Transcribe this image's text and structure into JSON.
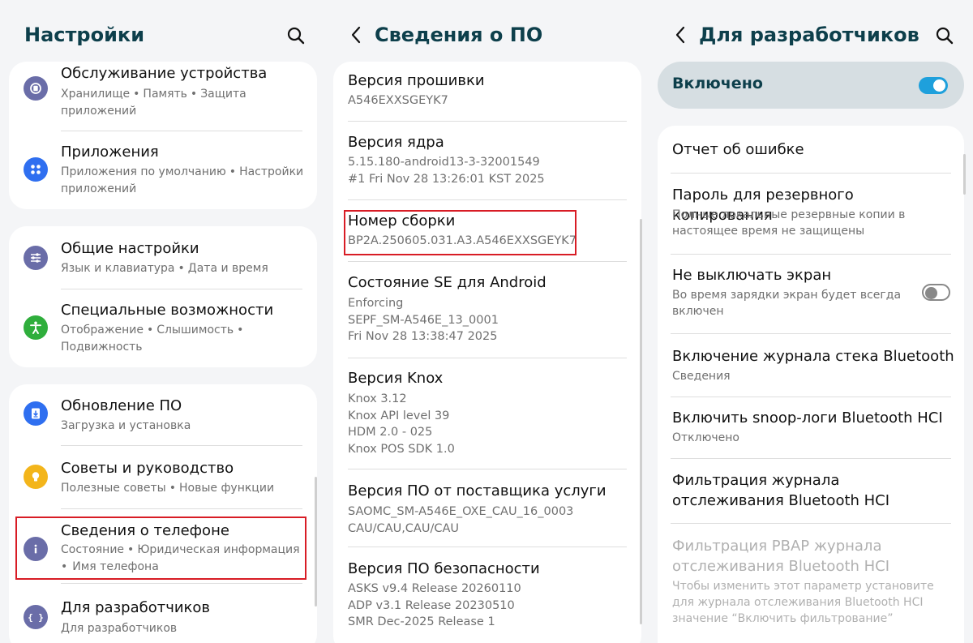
{
  "settings": {
    "title": "Настройки",
    "items": [
      {
        "title": "Обслуживание устройства",
        "sub_line1": [
          "Хранилище",
          "Память",
          "Защита"
        ],
        "sub_line2": "приложений"
      },
      {
        "title": "Приложения",
        "sub_line1": [
          "Приложения по умолчанию",
          "Настройки"
        ],
        "sub_line2": "приложений"
      },
      {
        "title": "Общие настройки",
        "sub_line1": [
          "Язык и клавиатура",
          "Дата и время"
        ]
      },
      {
        "title": "Специальные возможности",
        "sub_line1": [
          "Отображение",
          "Слышимость",
          ""
        ],
        "sub_line2": "Подвижность"
      },
      {
        "title": "Обновление ПО",
        "sub_line1": [
          "Загрузка и установка"
        ]
      },
      {
        "title": "Советы и руководство",
        "sub_line1": [
          "Полезные советы",
          "Новые функции"
        ]
      },
      {
        "title": "Сведения о телефоне",
        "sub_line1": [
          "Состояние",
          "Юридическая информация"
        ],
        "sub_line2_prefix": "•",
        "sub_line2": "Имя телефона"
      },
      {
        "title": "Для разработчиков",
        "sub_line1": [
          "Для разработчиков"
        ]
      }
    ],
    "dot": "•"
  },
  "software_info": {
    "title": "Сведения о ПО",
    "items": [
      {
        "title": "Версия прошивки",
        "lines": [
          "A546EXXSGEYK7"
        ]
      },
      {
        "title": "Версия ядра",
        "lines": [
          "5.15.180-android13-3-32001549",
          "#1 Fri Nov 28 13:26:01 KST 2025"
        ]
      },
      {
        "title": "Номер сборки",
        "lines": [
          "BP2A.250605.031.A3.A546EXXSGEYK7"
        ]
      },
      {
        "title": "Состояние SE для Android",
        "lines": [
          "Enforcing",
          "SEPF_SM-A546E_13_0001",
          "Fri Nov 28 13:38:47 2025"
        ]
      },
      {
        "title": "Версия Knox",
        "lines": [
          "Knox 3.12",
          "Knox API level 39",
          "HDM 2.0 - 025",
          "Knox POS SDK 1.0"
        ]
      },
      {
        "title": "Версия ПО от поставщика услуги",
        "lines": [
          "SAOMC_SM-A546E_OXE_CAU_16_0003",
          "CAU/CAU,CAU/CAU"
        ]
      },
      {
        "title": "Версия ПО безопасности",
        "lines": [
          "ASKS v9.4  Release 20260110",
          "ADP v3.1 Release 20230510",
          "SMR Dec-2025 Release 1"
        ]
      }
    ]
  },
  "developer": {
    "title": "Для разработчиков",
    "enabled_label": "Включено",
    "enabled_on": true,
    "items": [
      {
        "title": "Отчет об ошибке"
      },
      {
        "title": "Пароль для резервного копирования",
        "sub": "Полные локальные резервные копии в настоящее время не защищены"
      },
      {
        "title": "Не выключать экран",
        "sub": "Во время зарядки экран будет всегда включен",
        "toggle_on": false
      },
      {
        "title": "Включение журнала стека Bluetooth",
        "sub": "Сведения"
      },
      {
        "title": "Включить snoop-логи Bluetooth HCI",
        "sub": "Отключено"
      },
      {
        "title": "Фильтрация журнала отслеживания Bluetooth HCI"
      },
      {
        "title": "Фильтрация PBAP журнала отслеживания Bluetooth HCI",
        "sub": "Чтобы изменить этот параметр установите для журнала отслеживания Bluetooth HCI значение “Включить фильтрование”",
        "disabled": true
      }
    ]
  },
  "colors": {
    "header_text": "#0d3f4b",
    "highlight_border": "#d81c25",
    "toggle_on": "#1ea0dc",
    "toggle_off": "#888888"
  },
  "icons": {
    "settings_items": [
      "device-care-icon",
      "apps-icon",
      "general-management-icon",
      "accessibility-icon",
      "software-update-icon",
      "tips-icon",
      "about-phone-icon",
      "developer-options-icon"
    ]
  }
}
